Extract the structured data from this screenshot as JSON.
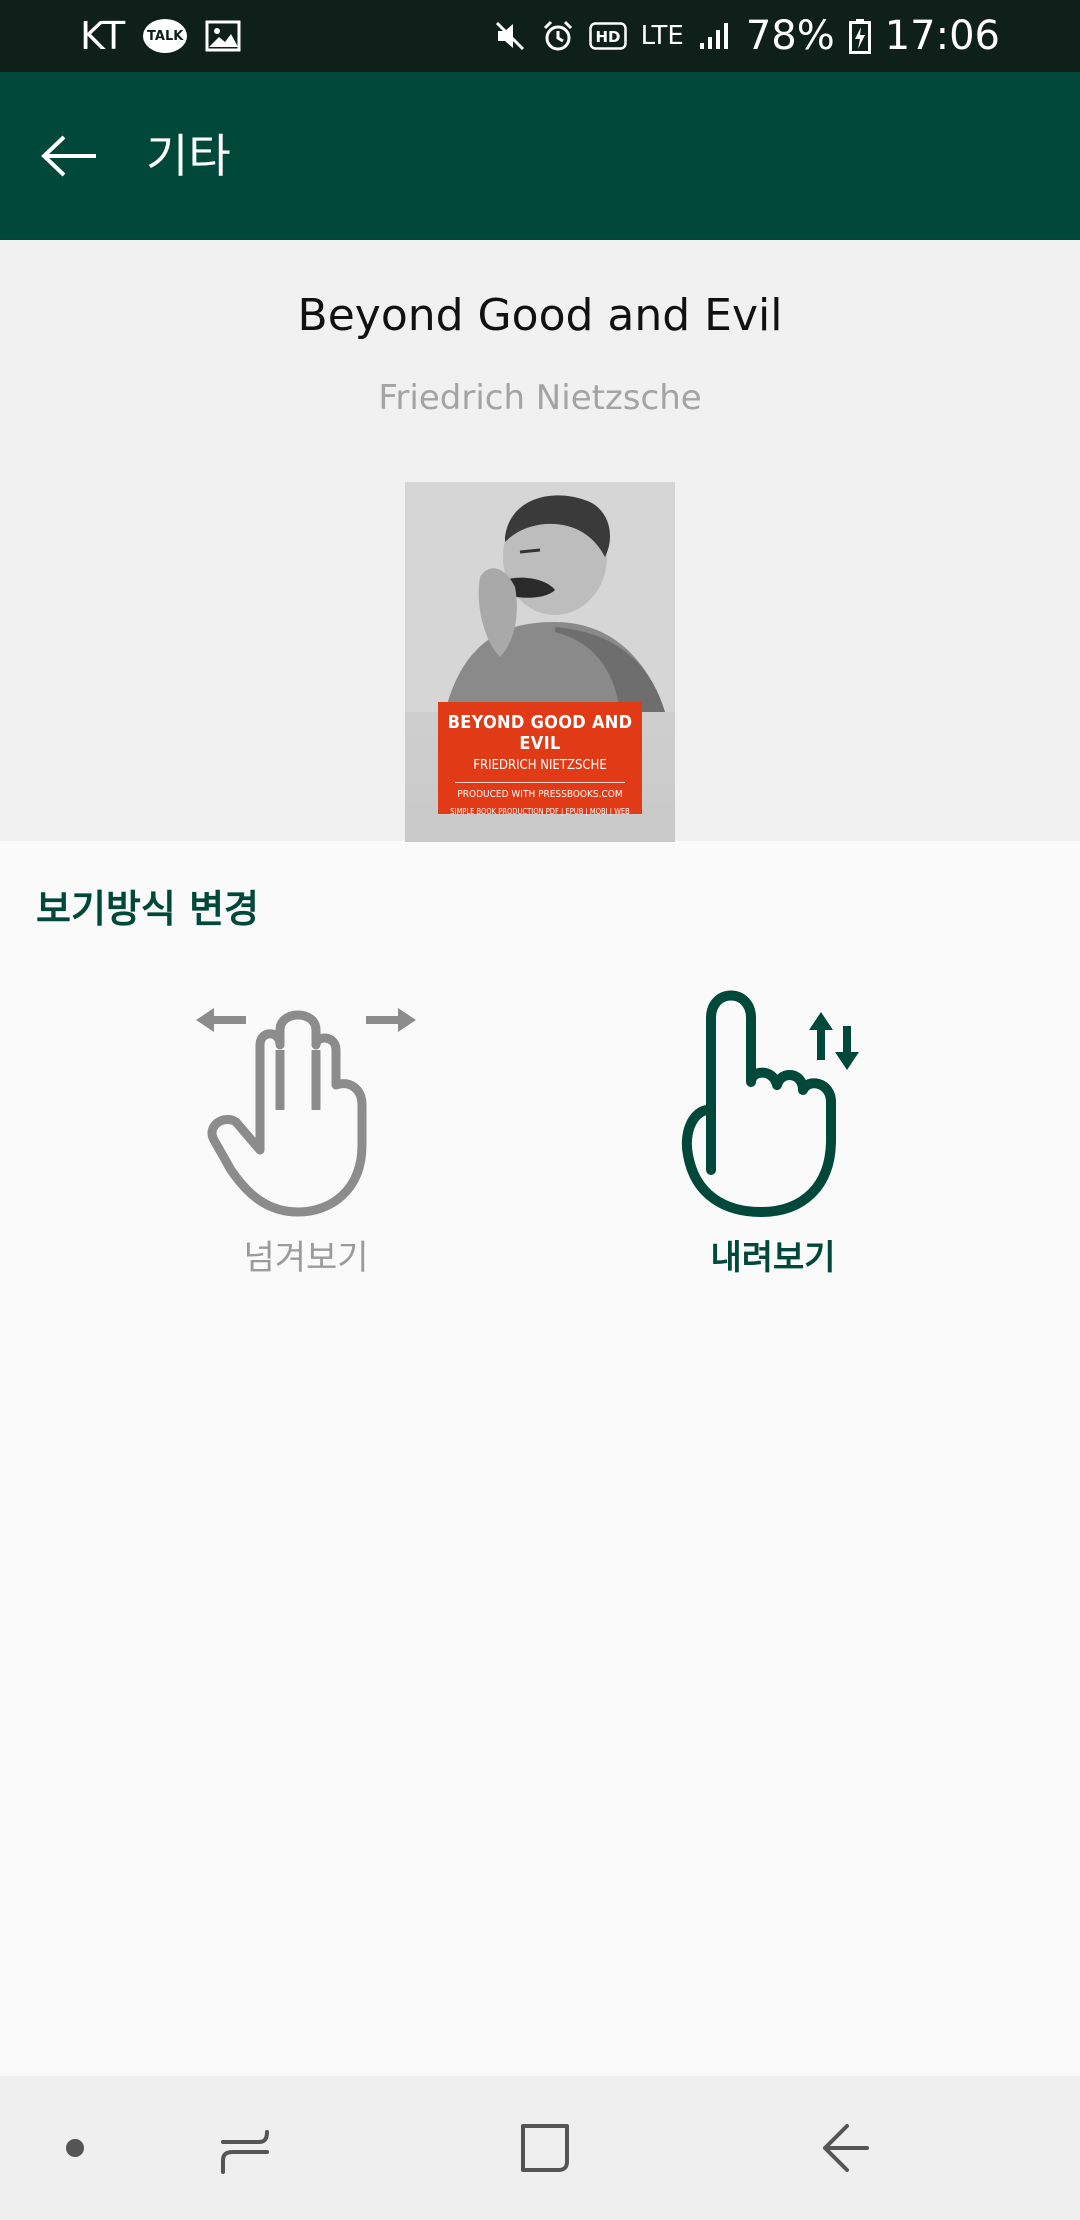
{
  "status_bar": {
    "carrier": "KT",
    "talk_badge": "TALK",
    "network": "LTE",
    "battery": "78%",
    "time": "17:06"
  },
  "app_bar": {
    "title": "기타"
  },
  "book": {
    "title": "Beyond Good and Evil",
    "author": "Friedrich Nietzsche",
    "cover": {
      "title": "BEYOND GOOD AND EVIL",
      "author": "FRIEDRICH NIETZSCHE",
      "publisher": "PRODUCED WITH PRESSBOOKS.COM",
      "formats": "SIMPLE BOOK PRODUCTION PDF | EPUB | MOBI | WEB"
    }
  },
  "view_mode": {
    "section_title": "보기방식 변경",
    "options": [
      {
        "label": "넘겨보기",
        "icon": "swipe-horizontal-icon",
        "selected": false
      },
      {
        "label": "내려보기",
        "icon": "scroll-vertical-icon",
        "selected": true
      }
    ]
  },
  "colors": {
    "primary": "#00483a",
    "status_bar": "#0f1f1a",
    "unselected": "#9b9b9b",
    "cover_label": "#e03a16"
  }
}
